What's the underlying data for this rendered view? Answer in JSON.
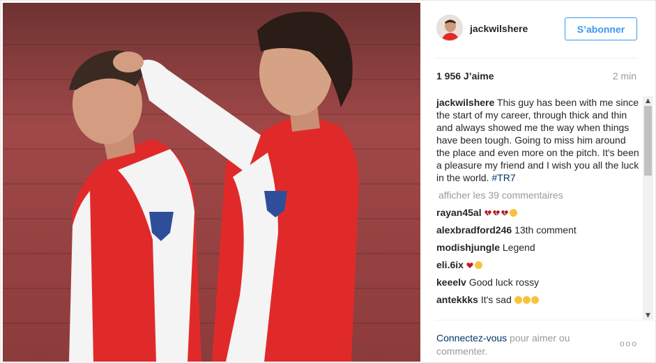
{
  "post": {
    "username": "jackwilshere",
    "follow_label": "S’abonner",
    "likes": "1 956 J’aime",
    "time": "2 min",
    "caption_user": "jackwilshere",
    "caption_text": " This guy has been with me since the start of my career, through thick and thin and always showed me the way when things have been tough. Going to miss him around the place and even more on the pitch. It's been a pleasure my friend and I wish you all the luck in the world. ",
    "caption_hashtag": "#TR7",
    "load_more": "afficher les 39 commentaires"
  },
  "comments": [
    {
      "user": "rayan45al",
      "text": "",
      "emoji": [
        "broken-heart",
        "broken-heart",
        "broken-heart",
        "smiling-face"
      ]
    },
    {
      "user": "alexbradford246",
      "text": " 13th comment",
      "emoji": []
    },
    {
      "user": "modishjungle",
      "text": " Legend",
      "emoji": []
    },
    {
      "user": "eli.6ix",
      "text": "",
      "emoji": [
        "heart",
        "crying-face"
      ]
    },
    {
      "user": "keeelv",
      "text": " Good luck rossy",
      "emoji": []
    },
    {
      "user": "antekkks",
      "text": " It's sad ",
      "emoji": [
        "sad-face",
        "sad-face",
        "sad-face"
      ]
    }
  ],
  "footer": {
    "login_link": "Connectez-vous",
    "login_text": " pour aimer ou commenter.",
    "more_dots": "ooo"
  },
  "colors": {
    "accent": "#3897f0",
    "link": "#003569",
    "muted": "#999999",
    "text": "#262626"
  }
}
